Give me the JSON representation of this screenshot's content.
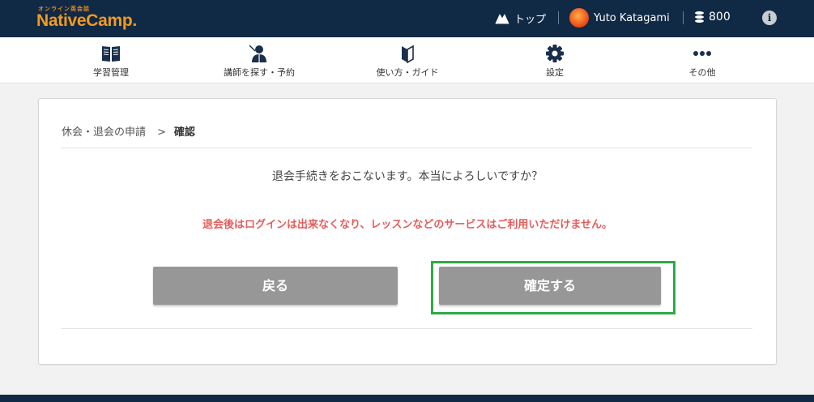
{
  "brand": {
    "tagline": "オンライン英会話",
    "name": "NativeCamp."
  },
  "header": {
    "top_label": "トップ",
    "user_name": "Yuto Katagami",
    "coins": "800",
    "info": "i"
  },
  "nav": {
    "items": [
      {
        "label": "学習管理",
        "icon": "book-icon"
      },
      {
        "label": "講師を探す・予約",
        "icon": "teacher-icon"
      },
      {
        "label": "使い方・ガイド",
        "icon": "guide-icon"
      },
      {
        "label": "設定",
        "icon": "gear-icon"
      },
      {
        "label": "その他",
        "icon": "more-icon"
      }
    ]
  },
  "breadcrumb": {
    "parent": "休会・退会の申請",
    "separator": ">",
    "current": "確認"
  },
  "confirm": {
    "question": "退会手続きをおこないます。本当によろしいですか？",
    "warning": "退会後はログインは出来なくなり、レッスンなどのサービスはご利用いただけません。",
    "back_label": "戻る",
    "confirm_label": "確定する"
  },
  "colors": {
    "header_bg": "#102945",
    "brand_orange": "#f39a1f",
    "warning_red": "#e65c5c",
    "button_gray": "#979797",
    "highlight_green": "#2eaa46"
  }
}
